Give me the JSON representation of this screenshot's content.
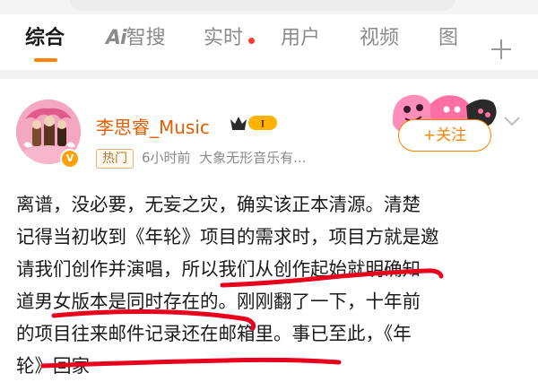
{
  "tabs": [
    {
      "label": "综合",
      "active": true
    },
    {
      "label": "AI智搜",
      "logo": "Ai",
      "text": "智搜"
    },
    {
      "label": "实时",
      "has_dot": true
    },
    {
      "label": "用户"
    },
    {
      "label": "视频"
    },
    {
      "label": "图"
    }
  ],
  "accent_color": "#ff8200",
  "post": {
    "username": "李思睿_Music",
    "level_badge": "I",
    "hot_label": "热门",
    "time": "6小时前",
    "source": "大象无形音乐有...",
    "follow_label": "+关注",
    "lines": [
      "离谱，没必要，无妄之灾，确实该正本清源。清楚",
      "记得当初收到《年轮》项目的需求时，项目方就是邀",
      "请我们创作并演唱，所以我们从创作起始就明确知",
      "道男女版本是同时存在的。刚刚翻了一下，十年前",
      "的项目往来邮件记录还在邮箱里。事已至此，《年",
      "轮》回家"
    ]
  }
}
